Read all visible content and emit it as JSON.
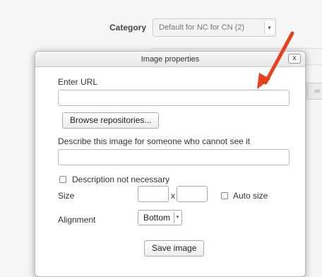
{
  "background": {
    "category_label": "Category",
    "category_value": "Default for NC for CN (2)"
  },
  "dialog": {
    "title": "Image properties",
    "close_label": "x",
    "url_label": "Enter URL",
    "url_value": "",
    "browse_label": "Browse repositories...",
    "describe_label": "Describe this image for someone who cannot see it",
    "describe_value": "",
    "desc_not_necessary_label": "Description not necessary",
    "size_label": "Size",
    "size_separator": "x",
    "width_value": "",
    "height_value": "",
    "auto_size_label": "Auto size",
    "alignment_label": "Alignment",
    "alignment_value": "Bottom",
    "save_label": "Save image"
  },
  "colors": {
    "annotation_arrow": "#e8401c"
  }
}
